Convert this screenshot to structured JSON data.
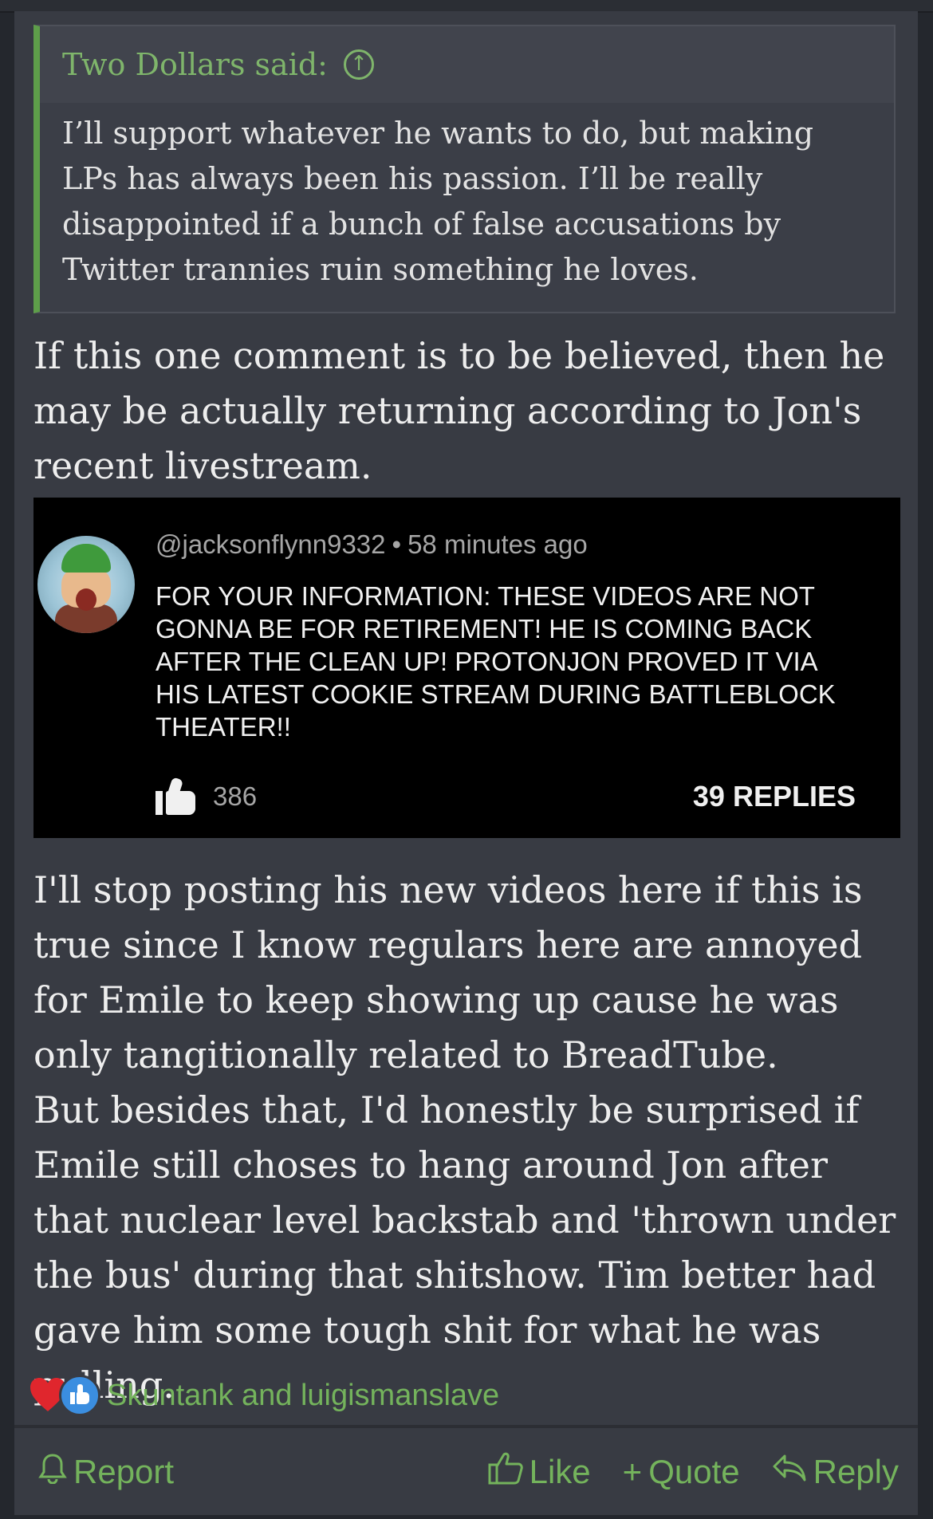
{
  "quote": {
    "author_label": "Two Dollars said:",
    "body": "I’ll support whatever he wants to do, but making LPs has always been his passion. I’ll be really disappointed if a bunch of false accusations by Twitter trannies ruin something he loves."
  },
  "intro_text": "If this one comment is to be believed, then he may be actually returning according to Jon's recent livestream.",
  "embedded_comment": {
    "handle": "@jacksonflynn9332",
    "separator": "•",
    "time": "58 minutes ago",
    "text": "FOR YOUR INFORMATION: THESE VIDEOS ARE NOT GONNA BE FOR RETIREMENT! HE IS COMING BACK AFTER THE CLEAN UP! PROTONJON PROVED IT VIA HIS LATEST COOKIE STREAM DURING BATTLEBLOCK THEATER!!",
    "like_count": "386",
    "replies_label": "39 REPLIES"
  },
  "main_text": {
    "paragraph1": "I'll stop posting his new videos here if this is true since I know regulars here are annoyed for Emile to keep showing up cause he was only tangitionally related to BreadTube.",
    "paragraph2": "But besides that, I'd honestly be surprised if Emile still choses to hang around Jon after that nuclear level backstab and 'thrown under the bus' during that shitshow. Tim better had gave him some tough shit for what he was pulling."
  },
  "reactions": {
    "names": "Skuntank and luigismanslave",
    "icons": [
      "heart-icon",
      "like-icon"
    ]
  },
  "actions": {
    "report": "Report",
    "like": "Like",
    "quote": "Quote",
    "reply": "Reply"
  },
  "colors": {
    "page_bg": "#24272d",
    "post_bg": "#383b43",
    "accent_green": "#74b35c",
    "quote_border": "#5e9e4a"
  }
}
